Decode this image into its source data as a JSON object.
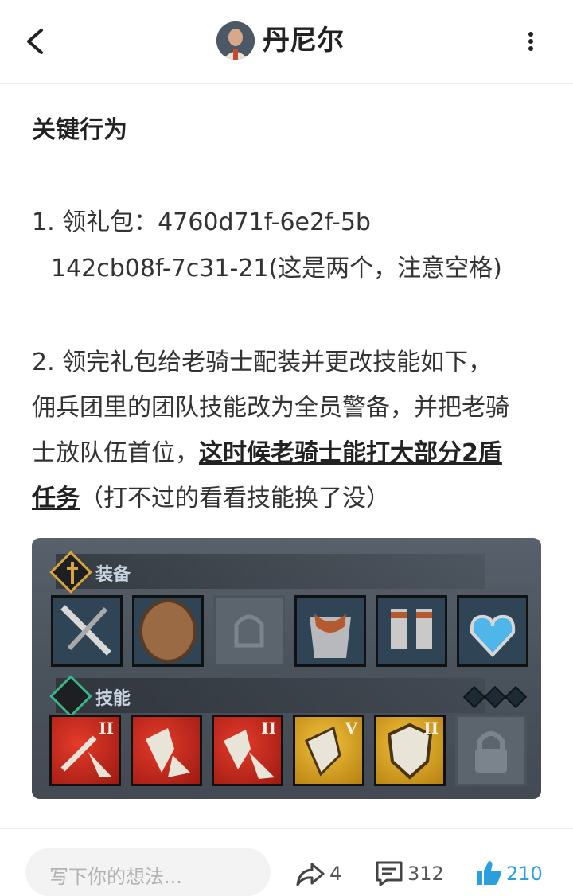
{
  "header": {
    "title": "丹尼尔",
    "back_icon": "back-arrow-icon",
    "more_icon": "more-vertical-icon"
  },
  "article": {
    "heading": "关键行为",
    "item1_line1": "1. 领礼包：4760d71f-6e2f-5b",
    "item1_line2": "142cb08f-7c31-21(这是两个，注意空格)",
    "item2_line1": "2. 领完礼包给老骑士配装并更改技能如下，",
    "item2_line2": "佣兵团里的团队技能改为全员警备，并把老骑",
    "item2_line3_prefix": "士放队伍首位，",
    "item2_line3_bold": "这时候老骑士能打大部分2盾",
    "item2_line4_bold": "任务",
    "item2_line4_suffix": "（打不过的看看技能换了没）"
  },
  "game_image": {
    "equip_label": "装备",
    "skill_label": "技能",
    "skill_levels": [
      "II",
      "",
      "II",
      "V",
      "II"
    ]
  },
  "footer": {
    "comment_placeholder": "写下你的想法...",
    "share_count": "4",
    "comment_count": "312",
    "like_count": "210",
    "accent_color": "#2a9fdf"
  }
}
